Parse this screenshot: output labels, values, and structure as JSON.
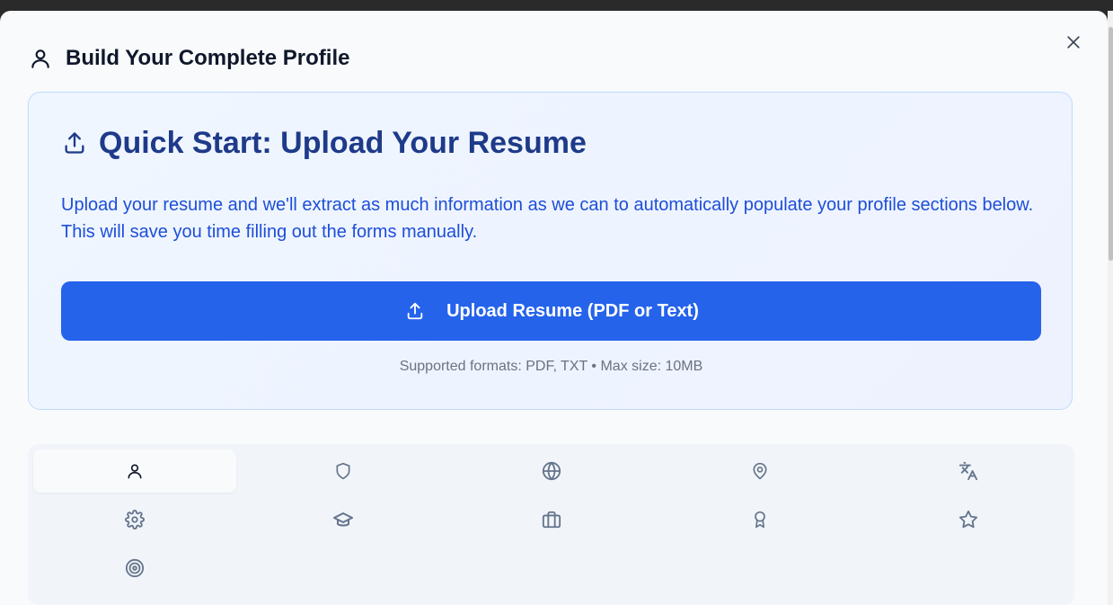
{
  "modal": {
    "title": "Build Your Complete Profile",
    "title_icon": "user-icon",
    "close_icon": "close-icon"
  },
  "upload_card": {
    "title": "Quick Start: Upload Your Resume",
    "title_icon": "upload-icon",
    "description": "Upload your resume and we'll extract as much information as we can to automatically populate your profile sections below. This will save you time filling out the forms manually.",
    "button_label": "Upload Resume (PDF or Text)",
    "button_icon": "upload-icon",
    "supported_formats": "Supported formats: PDF, TXT • Max size: 10MB",
    "colors": {
      "button": "#2563eb",
      "title": "#1e3a8a",
      "description": "#1d4ed8"
    }
  },
  "section_tabs": [
    {
      "icon": "user-icon",
      "active": true
    },
    {
      "icon": "shield-icon",
      "active": false
    },
    {
      "icon": "globe-icon",
      "active": false
    },
    {
      "icon": "map-pin-icon",
      "active": false
    },
    {
      "icon": "languages-icon",
      "active": false
    },
    {
      "icon": "settings-icon",
      "active": false
    },
    {
      "icon": "graduation-cap-icon",
      "active": false
    },
    {
      "icon": "briefcase-icon",
      "active": false
    },
    {
      "icon": "award-icon",
      "active": false
    },
    {
      "icon": "star-icon",
      "active": false
    },
    {
      "icon": "target-icon",
      "active": false
    }
  ]
}
